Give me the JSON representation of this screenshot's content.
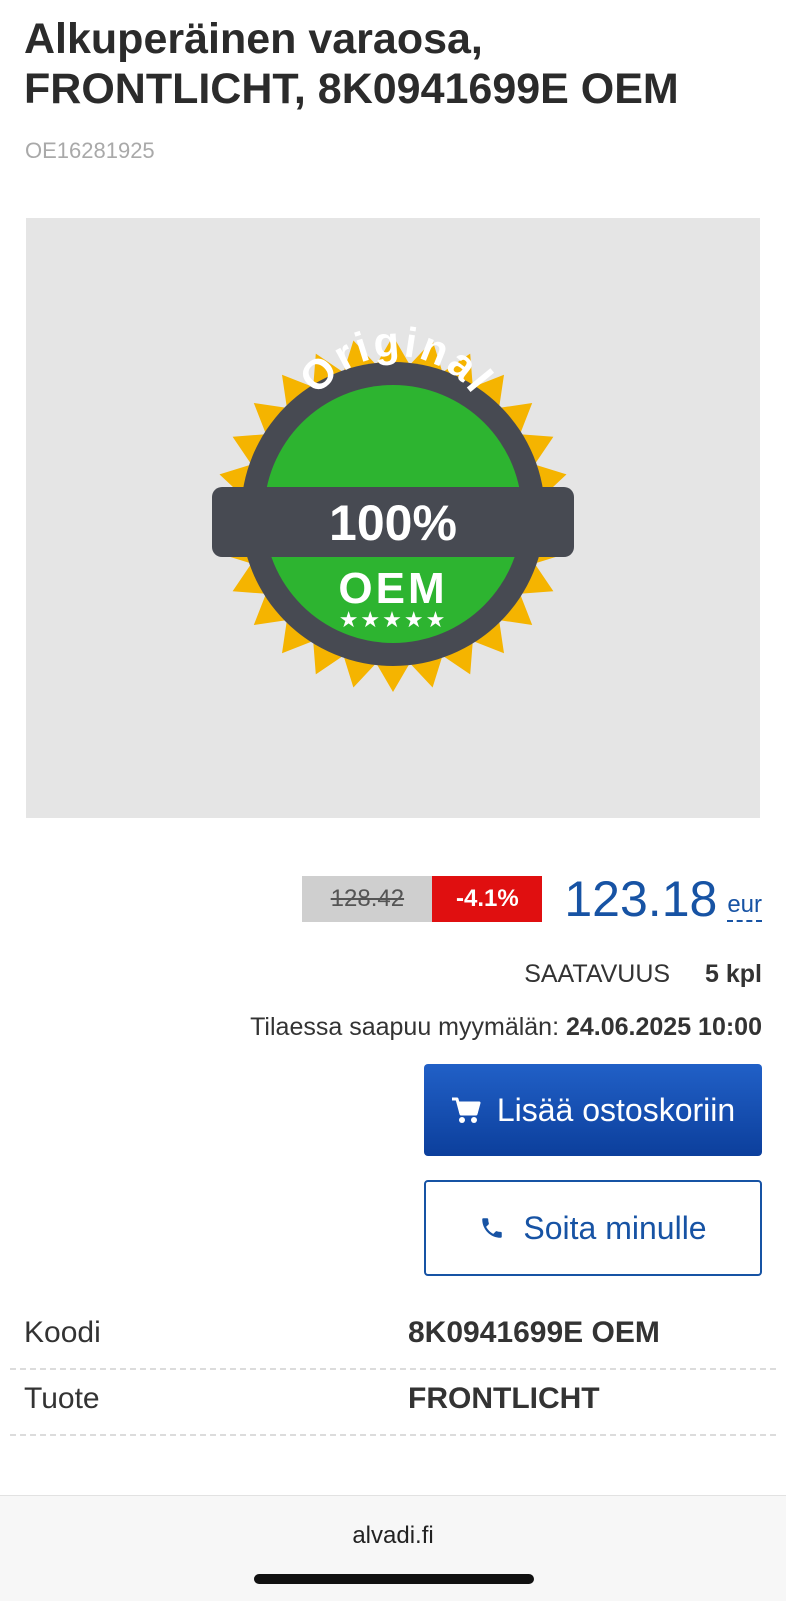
{
  "product": {
    "title_line1": "Alkuperäinen varaosa,",
    "title_line2": "FRONTLICHT, 8K0941699E OEM",
    "sku": "OE16281925"
  },
  "badge": {
    "arc_text": "Original",
    "percent": "100%",
    "label": "OEM",
    "stars": "★★★★★",
    "colors": {
      "sunburst": "#f5b400",
      "ring": "#474a52",
      "center": "#2db430",
      "text": "#ffffff"
    }
  },
  "pricing": {
    "old_price": "128.42",
    "discount": "-4.1%",
    "price": "123.18",
    "currency": "eur"
  },
  "availability": {
    "label": "SAATAVUUS",
    "value": "5 kpl",
    "arrival_label": "Tilaessa saapuu myymälän:",
    "arrival_value": "24.06.2025 10:00"
  },
  "actions": {
    "add_to_cart": "Lisää ostoskoriin",
    "call_me": "Soita minulle"
  },
  "specs": [
    {
      "label": "Koodi",
      "value": "8K0941699E OEM"
    },
    {
      "label": "Tuote",
      "value": "FRONTLICHT"
    }
  ],
  "browser": {
    "url": "alvadi.fi"
  },
  "colors": {
    "accent": "#1753a4",
    "discount_bg": "#e00f10",
    "old_price_bg": "#cfcfcf",
    "image_bg": "#e5e5e5"
  }
}
